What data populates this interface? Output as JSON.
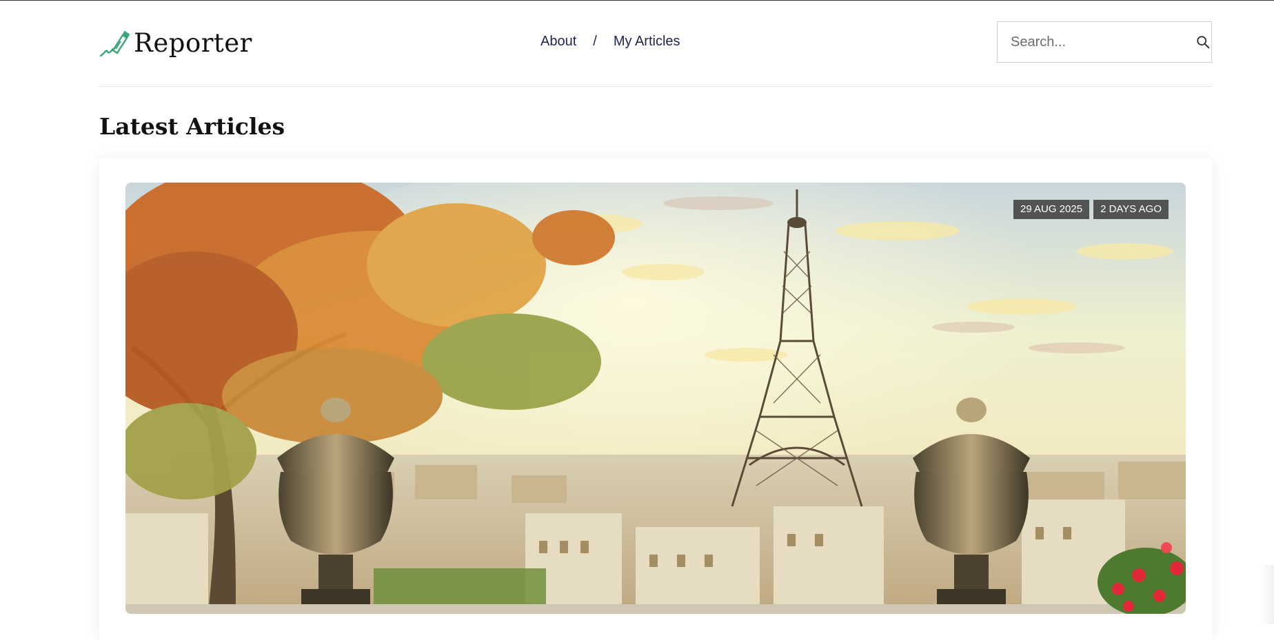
{
  "header": {
    "logo_text": "Reporter",
    "nav": {
      "about": "About",
      "separator": "/",
      "my_articles": "My Articles"
    },
    "search": {
      "placeholder": "Search...",
      "icon": "search-icon"
    }
  },
  "main": {
    "section_title": "Latest Articles",
    "featured_article": {
      "image_subject": "Eiffel Tower over Paris skyline with autumn tree and stone urns",
      "date": "29 AUG 2025",
      "relative_time": "2 DAYS AGO"
    }
  },
  "colors": {
    "nav_text": "#1b2350",
    "logo_accent": "#3aa77a",
    "badge_bg": "#3c3c3c"
  }
}
